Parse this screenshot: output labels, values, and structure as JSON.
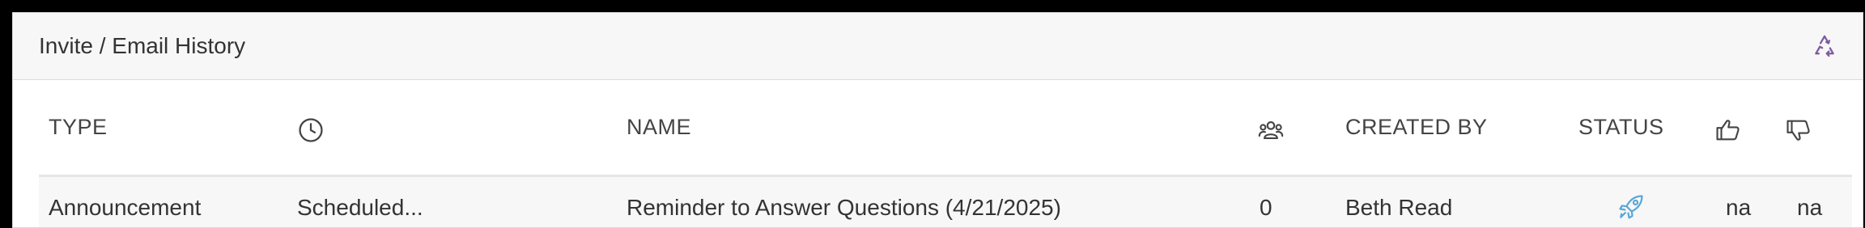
{
  "panel": {
    "title": "Invite / Email History",
    "refresh_icon": "recycle-icon"
  },
  "table": {
    "headers": {
      "type": "TYPE",
      "time_icon": "clock-icon",
      "name": "NAME",
      "recipients_icon": "people-icon",
      "created_by": "CREATED BY",
      "status": "STATUS",
      "likes_icon": "thumbs-up-icon",
      "dislikes_icon": "thumbs-down-icon"
    },
    "rows": [
      {
        "type": "Announcement",
        "time": "Scheduled...",
        "name": "Reminder to Answer Questions (4/21/2025)",
        "recipients": "0",
        "created_by": "Beth Read",
        "status_icon": "rocket-icon",
        "likes": "na",
        "dislikes": "na"
      }
    ]
  },
  "colors": {
    "accent_purple": "#7d5a9e",
    "status_blue": "#5aa7d6",
    "header_bg": "#f7f7f7"
  }
}
